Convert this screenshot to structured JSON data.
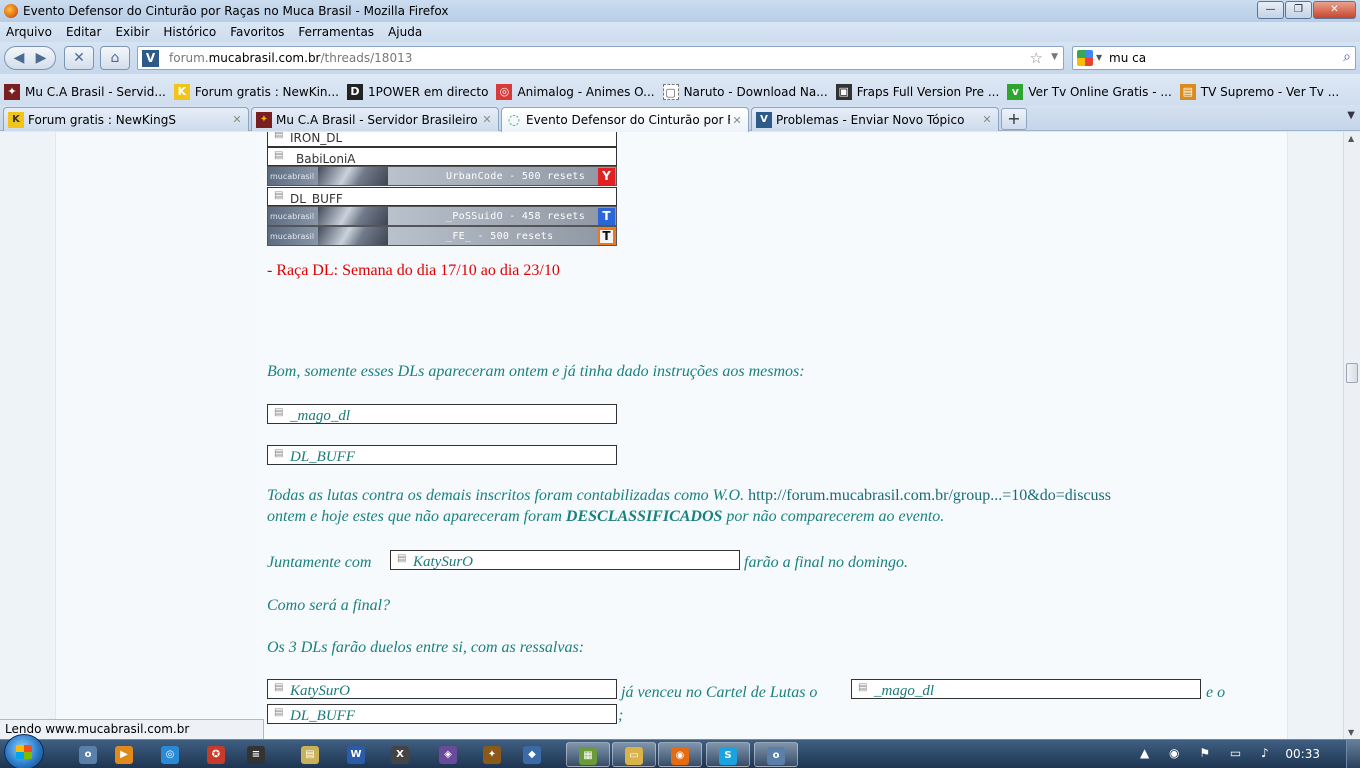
{
  "window": {
    "title": "Evento Defensor do Cinturão por Raças no Muca Brasil - Mozilla Firefox",
    "controls": {
      "minimize": "—",
      "maximize": "❐",
      "close": "✕"
    }
  },
  "menu": [
    "Arquivo",
    "Editar",
    "Exibir",
    "Histórico",
    "Favoritos",
    "Ferramentas",
    "Ajuda"
  ],
  "nav": {
    "back": "◀",
    "forward": "▶",
    "stop": "✕",
    "home": "⌂",
    "url_prefix": "forum.",
    "url_domain": "mucabrasil.com.br",
    "url_path": "/threads/18013",
    "search_query": "mu ca"
  },
  "bookmarks": [
    {
      "label": "Mu C.A Brasil - Servid...",
      "icon": "mu-icon",
      "color": "#7a1f1f",
      "glyph": "✦"
    },
    {
      "label": "Forum gratis : NewKin...",
      "icon": "forum-icon",
      "color": "#f0c419",
      "glyph": "K"
    },
    {
      "label": "1POWER em directo",
      "icon": "power-icon",
      "color": "#222222",
      "glyph": "D"
    },
    {
      "label": "Animalog - Animes O...",
      "icon": "animalog-icon",
      "color": "#d83a3a",
      "glyph": "◎"
    },
    {
      "label": "Naruto - Download Na...",
      "icon": "page-icon",
      "color": "#ffffff",
      "glyph": "▢"
    },
    {
      "label": "Fraps Full Version Pre ...",
      "icon": "fraps-icon",
      "color": "#333333",
      "glyph": "▣"
    },
    {
      "label": "Ver Tv Online Gratis - ...",
      "icon": "vto-icon",
      "color": "#2ea52e",
      "glyph": "v"
    },
    {
      "label": "TV Supremo - Ver Tv ...",
      "icon": "tv-icon",
      "color": "#d98b1b",
      "glyph": "▤"
    }
  ],
  "tabs": [
    {
      "label": "Forum gratis : NewKingS",
      "icon_color": "#f0c419",
      "glyph": "K",
      "close": "✕"
    },
    {
      "label": "Mu C.A Brasil - Servidor Brasileiro de ...",
      "icon_color": "#7a1f1f",
      "glyph": "✦",
      "close": "✕"
    },
    {
      "label": "Evento Defensor do Cinturão por Raç...",
      "icon_color": "#39a84b",
      "glyph": "◌",
      "close": "✕"
    },
    {
      "label": "Problemas - Enviar Novo Tópico",
      "icon_color": "#2e5a8a",
      "glyph": "V",
      "close": "✕"
    }
  ],
  "newtab": "+",
  "tablist": "▼",
  "post": {
    "top_names": [
      "IRON_DL",
      "_BabiLoniA",
      "DL_BUFF"
    ],
    "banners": [
      {
        "text": "UrbanCode - 500 resets",
        "brand": "mucabrasil",
        "badge": "Y",
        "badge_color": "#e22222"
      },
      {
        "text": "_PoSSuidO - 458 resets",
        "brand": "mucabrasil",
        "badge": "T",
        "badge_color": "#2b66d9"
      },
      {
        "text": "_FE_ - 500 resets",
        "brand": "mucabrasil",
        "badge": "T",
        "badge_color": "#e87722"
      }
    ],
    "race_heading": "- Raça DL: Semana do dia 17/10 ao dia 23/10",
    "p1": "Bom, somente esses DLs apareceram ontem e já tinha dado instruções aos mesmos:",
    "img_mago": "_mago_dl",
    "img_dlbuff": "DL_BUFF",
    "p2_a": "Todas as lutas contra os demais inscritos foram contabilizadas como W.O.",
    "p2_link": "http://forum.mucabrasil.com.br/group...=10&do=discuss",
    "p2_b": "ontem e hoje estes que não apareceram foram",
    "p2_bold": "DESCLASSIFICADOS",
    "p2_c": "por não comparecerem ao evento.",
    "p3_a": "Juntamente com",
    "img_katy": "KatySurO",
    "p3_b": "farão a final no domingo.",
    "p4": "Como será a final?",
    "p5": "Os 3 DLs farão duelos entre si, com as ressalvas:",
    "p6_a": "já venceu no Cartel de Lutas o",
    "p6_b": "e o",
    "p6_c": ";"
  },
  "status": "Lendo www.mucabrasil.com.br",
  "taskbar": {
    "clock": "00:33",
    "apps": [
      {
        "name": "orb-app",
        "color": "#5a7fa8",
        "glyph": "o"
      },
      {
        "name": "media-player",
        "color": "#e08a1a",
        "glyph": "▶"
      },
      {
        "name": "app-blue",
        "color": "#2a8ad6",
        "glyph": "◎"
      },
      {
        "name": "game-red",
        "color": "#c83a2a",
        "glyph": "✪"
      },
      {
        "name": "terminal",
        "color": "#333333",
        "glyph": "≡"
      },
      {
        "name": "notepad",
        "color": "#c9b15a",
        "glyph": "▤"
      },
      {
        "name": "word",
        "color": "#2a5caa",
        "glyph": "W"
      },
      {
        "name": "xfire",
        "color": "#444444",
        "glyph": "X"
      },
      {
        "name": "shield-app",
        "color": "#6a4a9a",
        "glyph": "◈"
      },
      {
        "name": "mu-game",
        "color": "#8a5a1a",
        "glyph": "✦"
      },
      {
        "name": "virtualbox",
        "color": "#3a6aa8",
        "glyph": "◆"
      },
      {
        "name": "explorer",
        "color": "#6a9a3a",
        "glyph": "▦"
      },
      {
        "name": "folder",
        "color": "#d9b24a",
        "glyph": "▭"
      },
      {
        "name": "firefox",
        "color": "#e46a14",
        "glyph": "◉"
      },
      {
        "name": "skype",
        "color": "#1aa3e0",
        "glyph": "S"
      },
      {
        "name": "orb-app-2",
        "color": "#5a7fa8",
        "glyph": "o"
      }
    ]
  }
}
